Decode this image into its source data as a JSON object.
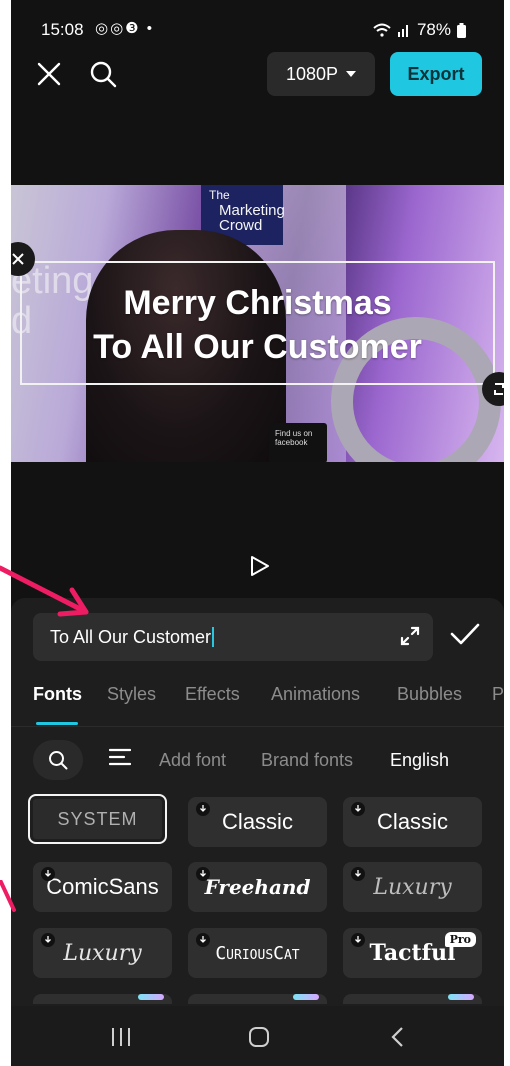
{
  "status_bar": {
    "time": "15:08",
    "app_icons": "◎◎❸ •",
    "battery": "78%"
  },
  "toolbar": {
    "resolution_label": "1080P",
    "export_label": "Export"
  },
  "preview": {
    "caption_lines": [
      "Merry Christmas",
      "To All Our Customer"
    ],
    "sign_lines": [
      "The",
      "Marketing",
      "Crowd"
    ],
    "wall_text_lines": [
      "eting",
      "d"
    ],
    "fb_sign_text": "Find us on facebook"
  },
  "text_editor": {
    "value": "To All Our Customer"
  },
  "tabs": [
    "Fonts",
    "Styles",
    "Effects",
    "Animations",
    "Bubbles",
    "P"
  ],
  "font_filters": {
    "add_font": "Add font",
    "brand_fonts": "Brand fonts",
    "english": "English"
  },
  "fonts": [
    {
      "label": "SYSTEM"
    },
    {
      "label": "Classic"
    },
    {
      "label": "Classic"
    },
    {
      "label": "ComicSans"
    },
    {
      "label": "Freehand"
    },
    {
      "label": "Luxury"
    },
    {
      "label": "Luxury"
    },
    {
      "label": "CuriousCat"
    },
    {
      "label": "Tactful",
      "badge": "Pro"
    }
  ],
  "colors": {
    "accent": "#1fc7e0",
    "panel": "#1e1e1e",
    "annotation_arrow": "#ee1d63"
  }
}
